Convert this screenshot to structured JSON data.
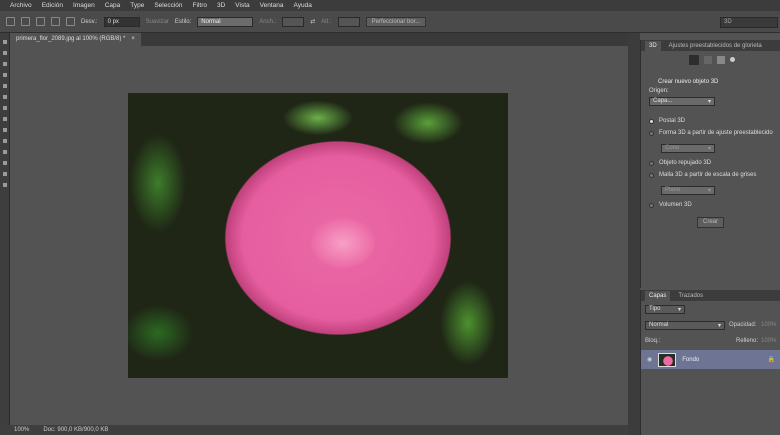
{
  "menu": [
    "Archivo",
    "Edición",
    "Imagen",
    "Capa",
    "Type",
    "Selección",
    "Filtro",
    "3D",
    "Vista",
    "Ventana",
    "Ayuda"
  ],
  "options": {
    "feather_label": "Desv.:",
    "feather_value": "0 px",
    "smooth_label": "Suavizar",
    "style_label": "Estilo:",
    "style_value": "Normal",
    "width_label": "Anch.:",
    "height_label": "Alt.:",
    "refine_button": "Perfeccionar bor..."
  },
  "workspace": "3D",
  "document_tab": {
    "title": "primera_flor_2089.jpg al 100% (RGB/8) *",
    "close": "×"
  },
  "status": {
    "zoom": "100%",
    "doc": "Doc: 900,0 KB/900,0 KB"
  },
  "panel3d": {
    "tab": "3D",
    "subtitle": "Ajustes preestablecidos de glorieta",
    "heading": "Crear nuevo objeto 3D",
    "origin_label": "Origen:",
    "origin_value": "Capa...",
    "options": [
      {
        "label": "Postal 3D",
        "selected": true
      },
      {
        "label": "Forma 3D a partir de ajuste preestablecido",
        "selected": false
      },
      {
        "label": "Objeto repujado 3D",
        "selected": false
      },
      {
        "label": "Malla 3D a partir de escala de grises",
        "selected": false
      },
      {
        "label": "Volumen 3D",
        "selected": false
      }
    ],
    "preset_shape": "Cono",
    "preset_mesh": "Plano",
    "create_button": "Crear"
  },
  "layers": {
    "tabs": [
      "Capas",
      "Trazados"
    ],
    "kind": "Tipo",
    "blend": "Normal",
    "opacity_label": "Opacidad:",
    "opacity": "100%",
    "lock_label": "Bloq.:",
    "fill_label": "Relleno:",
    "fill": "100%",
    "layer_name": "Fondo"
  }
}
